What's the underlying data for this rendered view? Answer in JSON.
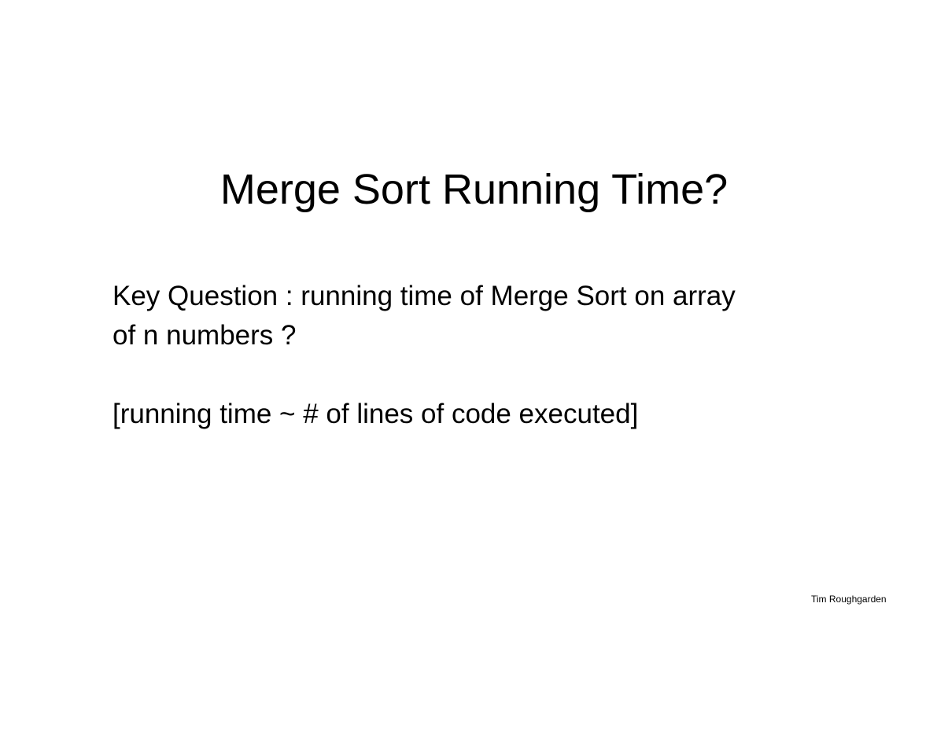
{
  "slide": {
    "title": "Merge Sort Running Time?",
    "body_lines": [
      "Key Question : running time of Merge Sort on array",
      "of n numbers ?",
      "[running time ~ # of lines of code executed]"
    ],
    "author": "Tim Roughgarden"
  }
}
